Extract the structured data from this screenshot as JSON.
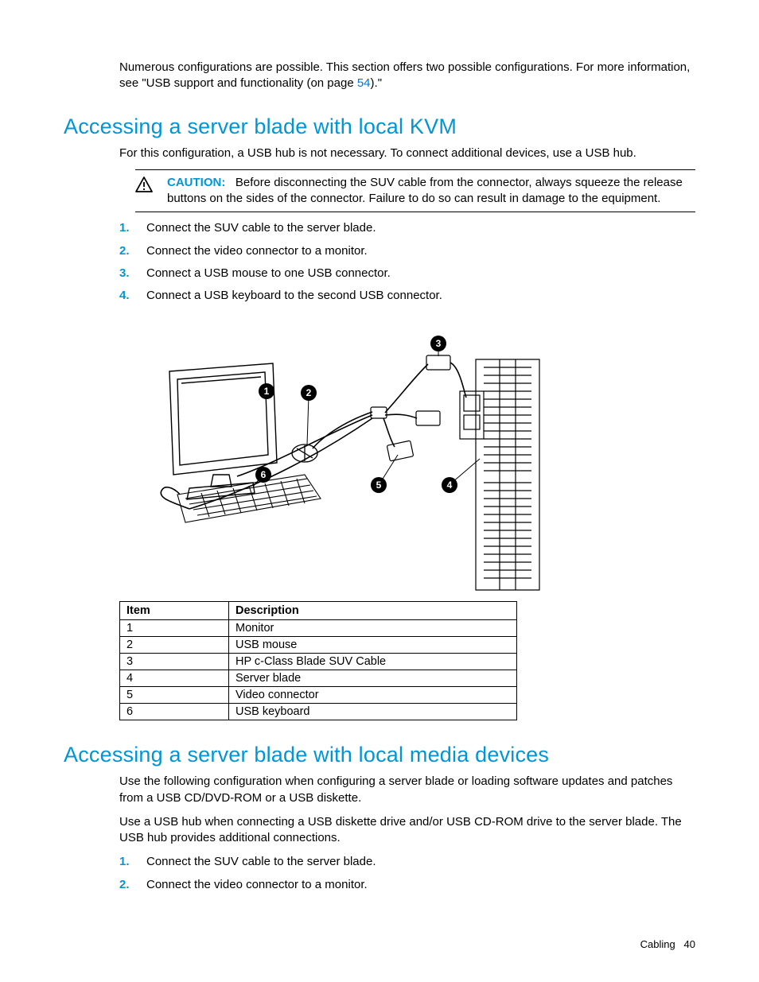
{
  "intro": {
    "text_before_link": "Numerous configurations are possible. This section offers two possible configurations. For more information, see \"USB support and functionality (on page ",
    "link_text": "54",
    "text_after_link": ").\""
  },
  "section1": {
    "title": "Accessing a server blade with local KVM",
    "lead": "For this configuration, a USB hub is not necessary. To connect additional devices, use a USB hub.",
    "caution_label": "CAUTION:",
    "caution_text": "Before disconnecting the SUV cable from the connector, always squeeze the release buttons on the sides of the connector. Failure to do so can result in damage to the equipment.",
    "steps": [
      "Connect the SUV cable to the server blade.",
      "Connect the video connector to a monitor.",
      "Connect a USB mouse to one USB connector.",
      "Connect a USB keyboard to the second USB connector."
    ],
    "diagram_callouts": [
      "1",
      "2",
      "3",
      "4",
      "5",
      "6"
    ],
    "table": {
      "headers": [
        "Item",
        "Description"
      ],
      "rows": [
        [
          "1",
          "Monitor"
        ],
        [
          "2",
          "USB mouse"
        ],
        [
          "3",
          "HP c-Class Blade SUV Cable"
        ],
        [
          "4",
          "Server blade"
        ],
        [
          "5",
          "Video connector"
        ],
        [
          "6",
          "USB keyboard"
        ]
      ]
    }
  },
  "section2": {
    "title": "Accessing a server blade with local media devices",
    "para1": "Use the following configuration when configuring a server blade or loading software updates and patches from a USB CD/DVD-ROM or a USB diskette.",
    "para2": "Use a USB hub when connecting a USB diskette drive and/or USB CD-ROM drive to the server blade. The USB hub provides additional connections.",
    "steps": [
      "Connect the SUV cable to the server blade.",
      "Connect the video connector to a monitor."
    ]
  },
  "footer": {
    "section": "Cabling",
    "page": "40"
  }
}
